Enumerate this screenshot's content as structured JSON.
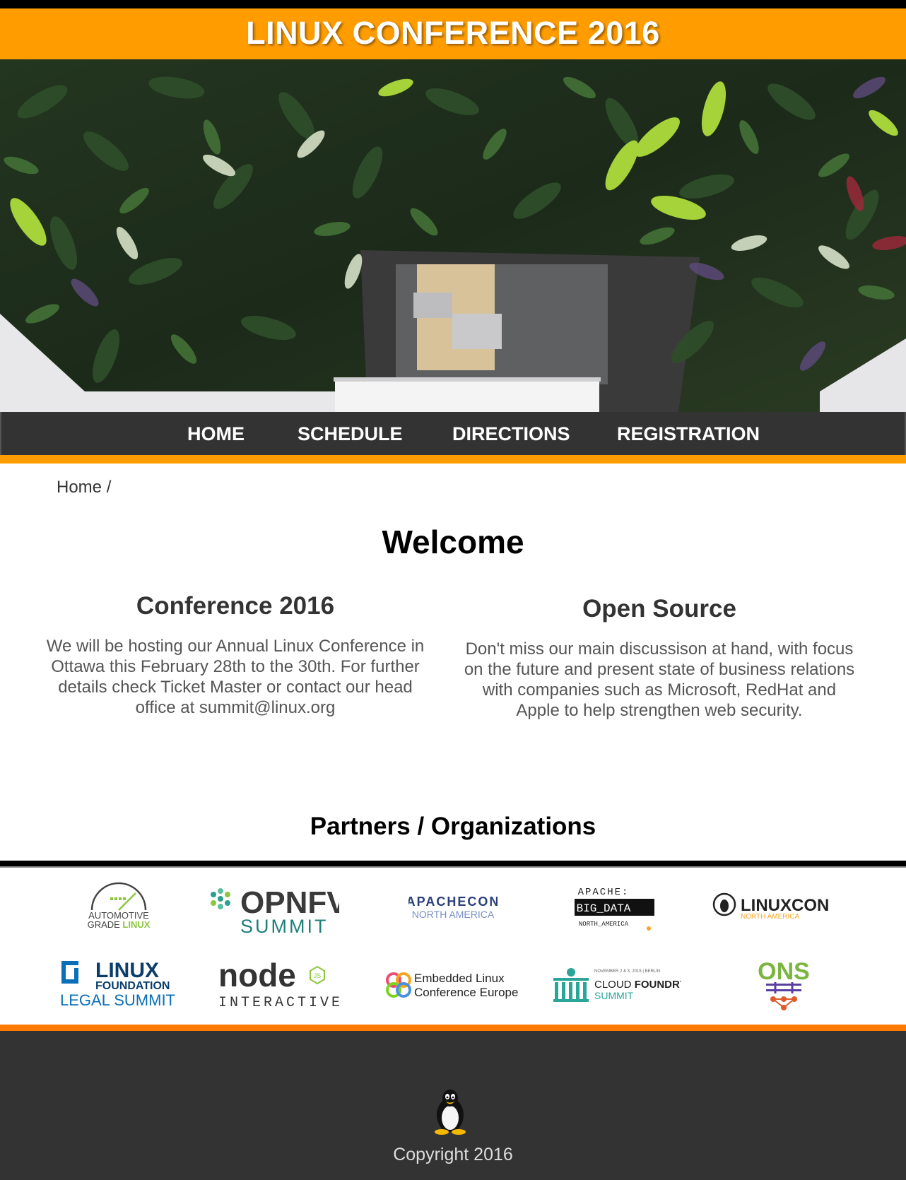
{
  "header": {
    "title": "LINUX CONFERENCE 2016"
  },
  "nav": {
    "items": [
      {
        "label": "HOME"
      },
      {
        "label": "SCHEDULE"
      },
      {
        "label": "DIRECTIONS"
      },
      {
        "label": "REGISTRATION"
      }
    ]
  },
  "breadcrumb": {
    "label": "Home /"
  },
  "main": {
    "heading": "Welcome",
    "left": {
      "title": "Conference 2016",
      "text": "We will be hosting our Annual Linux Conference in Ottawa this February 28th to the 30th. For further details check Ticket Master or contact our head office at summit@linux.org"
    },
    "right": {
      "title": "Open Source",
      "text": "Don't miss our main discussison at hand, with focus on the future and present state of business relations with companies such as Microsoft, RedHat and Apple to help strengthen web security."
    }
  },
  "partners": {
    "title": "Partners / Organizations",
    "logos": {
      "agl": {
        "line1": "AUTOMOTIVE",
        "line2a": "GRADE ",
        "line2b": "LINUX"
      },
      "opnfv": {
        "line1": "OPNFV",
        "line2": "SUMMIT"
      },
      "apachecon": {
        "line1": "APACHECON",
        "line2": "NORTH AMERICA"
      },
      "bigdata": {
        "line1": "APACHE:",
        "line2": "BIG_DATA",
        "line3": "NORTH_AMERICA"
      },
      "linuxcon": {
        "line1": "LINUXCON",
        "line2": "NORTH AMERICA"
      },
      "lflegal": {
        "line1": "LINUX",
        "line2": "FOUNDATION",
        "line3": "LEGAL SUMMIT"
      },
      "node": {
        "line1": "node",
        "line2": "INTERACTIVE",
        "badge": "JS"
      },
      "elce": {
        "line1": "Embedded Linux",
        "line2": "Conference Europe"
      },
      "cloudfoundry": {
        "line0": "NOVEMBER 2 & 3, 2015  |  BERLIN",
        "line1a": "CLOUD ",
        "line1b": "FOUNDRY",
        "line2": "SUMMIT"
      },
      "ons": {
        "line1": "ONS"
      }
    }
  },
  "footer": {
    "copyright": "Copyright 2016"
  },
  "colors": {
    "accent_orange": "#ff9c00",
    "footer_rule": "#ff7a00",
    "nav_bg": "#333333",
    "footer_bg": "#333333"
  },
  "icons": [
    "tux-penguin-icon",
    "opnfv-flower-icon",
    "agl-gauge-icon",
    "elce-knot-icon",
    "cloudfoundry-gate-icon",
    "ons-network-icon",
    "linuxcon-penguin-icon"
  ]
}
